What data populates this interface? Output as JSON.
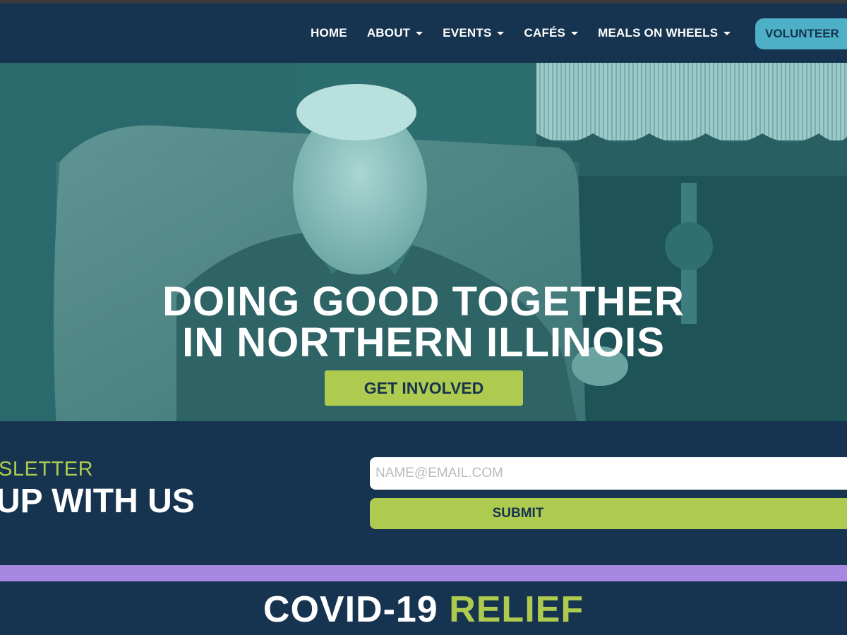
{
  "nav": {
    "items": [
      {
        "label": "HOME",
        "dropdown": false
      },
      {
        "label": "ABOUT",
        "dropdown": true
      },
      {
        "label": "EVENTS",
        "dropdown": true
      },
      {
        "label": "CAFÉS",
        "dropdown": true
      },
      {
        "label": "MEALS ON WHEELS",
        "dropdown": true
      }
    ],
    "volunteer_label": "VOLUNTEER"
  },
  "hero": {
    "title_line1": "DOING GOOD TOGETHER",
    "title_line2": "IN NORTHERN ILLINOIS",
    "cta_label": "GET INVOLVED"
  },
  "newsletter": {
    "eyebrow": "SLETTER",
    "heading": "UP WITH US",
    "email_placeholder": "NAME@EMAIL.COM",
    "submit_label": "SUBMIT"
  },
  "covid": {
    "title_white": "COVID-19",
    "title_green": "RELIEF"
  },
  "colors": {
    "navy": "#16334f",
    "accent_green": "#aecb4f",
    "accent_teal": "#4db0c6",
    "band_purple": "#a688e2"
  }
}
